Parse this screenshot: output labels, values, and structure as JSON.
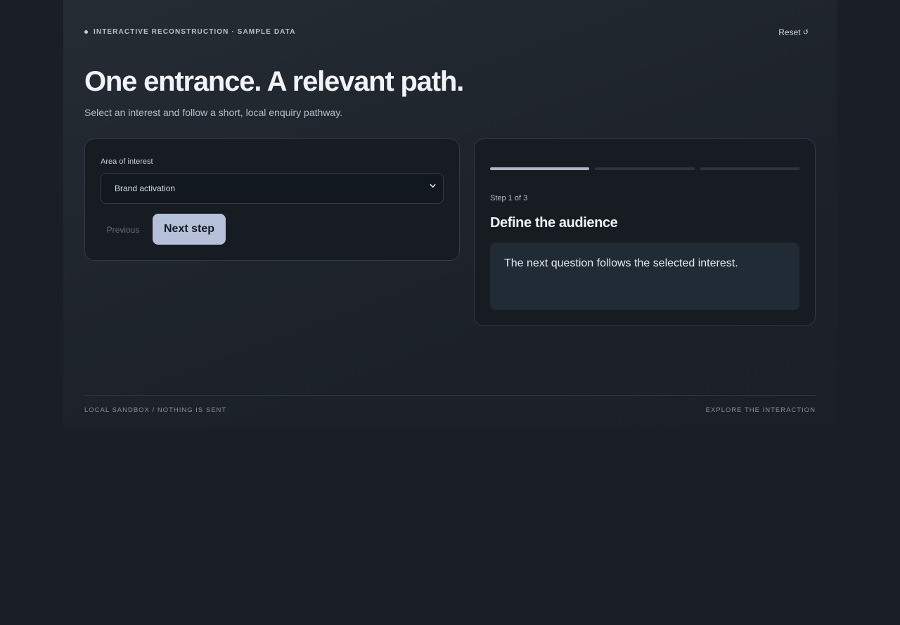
{
  "header": {
    "eyebrow": "INTERACTIVE RECONSTRUCTION · SAMPLE DATA",
    "reset_label": "Reset",
    "reset_icon": "refresh-icon"
  },
  "hero": {
    "title": "One entrance. A relevant path.",
    "subtitle": "Select an interest and follow a short, local enquiry pathway."
  },
  "form": {
    "interest_label": "Area of interest",
    "interest_value": "Brand activation",
    "previous_label": "Previous",
    "next_label": "Next step"
  },
  "stepper": {
    "progress": {
      "current": 1,
      "total": 3
    },
    "step_label": "Step 1 of 3",
    "step_title": "Define the audience",
    "question": "The next question follows the selected interest."
  },
  "footer": {
    "left": "LOCAL SANDBOX / NOTHING IS SENT",
    "right": "EXPLORE THE INTERACTION"
  },
  "colors": {
    "background": "#1a1f27",
    "card": "#171c23",
    "accent": "#b5c1d9",
    "progress_active": "#aab5ca",
    "question_box": "#212b35"
  }
}
